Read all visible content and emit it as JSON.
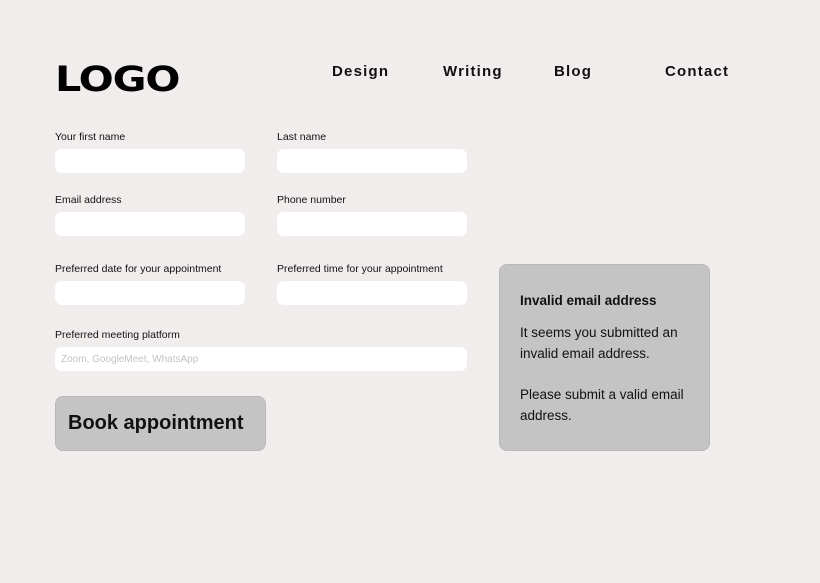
{
  "header": {
    "logo": "LOGO",
    "nav": [
      "Design",
      "Writing",
      "Blog",
      "Contact"
    ]
  },
  "form": {
    "first_name": {
      "label": "Your first name",
      "value": "",
      "placeholder": ""
    },
    "last_name": {
      "label": "Last name",
      "value": "",
      "placeholder": ""
    },
    "email": {
      "label": "Email address",
      "value": "",
      "placeholder": ""
    },
    "phone": {
      "label": "Phone number",
      "value": "",
      "placeholder": ""
    },
    "date": {
      "label": "Preferred date for your appointment",
      "value": "",
      "placeholder": ""
    },
    "time": {
      "label": "Preferred time for your appointment",
      "value": "",
      "placeholder": ""
    },
    "platform": {
      "label": "Preferred meeting platform",
      "value": "",
      "placeholder": "Zoom, GoogleMeet, WhatsApp"
    },
    "submit_label": "Book appointment"
  },
  "error": {
    "title": "Invalid email address",
    "line1": "It seems you submitted an invalid email address.",
    "line2": "Please submit a valid email address."
  },
  "colors": {
    "background": "#f2eded",
    "panel": "#c4c4c4",
    "input": "#ffffff"
  }
}
